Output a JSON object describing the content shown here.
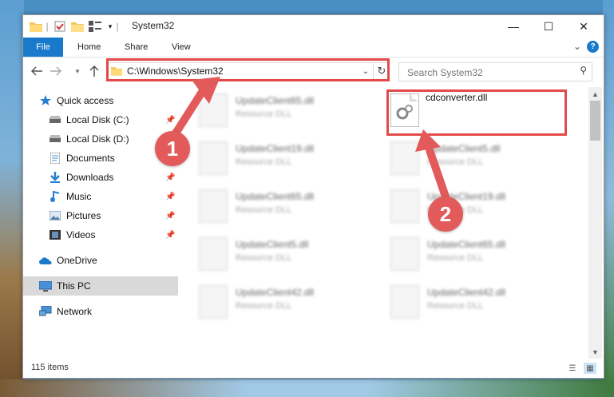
{
  "window": {
    "title": "System32",
    "controls": {
      "minimize": "—",
      "maximize": "☐",
      "close": "✕"
    }
  },
  "ribbon": {
    "tabs": [
      {
        "label": "File",
        "active": true
      },
      {
        "label": "Home"
      },
      {
        "label": "Share"
      },
      {
        "label": "View"
      }
    ],
    "help": "?"
  },
  "navbar": {
    "address": "C:\\Windows\\System32",
    "search_placeholder": "Search System32"
  },
  "sidebar": {
    "items": [
      {
        "label": "Quick access",
        "icon": "star-icon",
        "pinned": false
      },
      {
        "label": "Local Disk (C:)",
        "icon": "drive-icon",
        "pinned": true
      },
      {
        "label": "Local Disk (D:)",
        "icon": "drive-icon",
        "pinned": false
      },
      {
        "label": "Documents",
        "icon": "documents-icon",
        "pinned": true
      },
      {
        "label": "Downloads",
        "icon": "download-icon",
        "pinned": true
      },
      {
        "label": "Music",
        "icon": "music-icon",
        "pinned": true
      },
      {
        "label": "Pictures",
        "icon": "pictures-icon",
        "pinned": true
      },
      {
        "label": "Videos",
        "icon": "videos-icon",
        "pinned": true
      },
      {
        "label": "OneDrive",
        "icon": "cloud-icon",
        "pinned": false
      },
      {
        "label": "This PC",
        "icon": "pc-icon",
        "pinned": false,
        "selected": true
      },
      {
        "label": "Network",
        "icon": "network-icon",
        "pinned": false
      }
    ]
  },
  "files": [
    {
      "name": "UpdateClient65.dll",
      "type": "Resource DLL"
    },
    {
      "name": "cdconverter.dll",
      "type": ""
    },
    {
      "name": "UpdateClient19.dll",
      "type": "Resource DLL"
    },
    {
      "name": "UpdateClient5.dll",
      "type": "Resource DLL"
    },
    {
      "name": "UpdateClient65.dll",
      "type": "Resource DLL"
    },
    {
      "name": "UpdateClient19.dll",
      "type": "Resource DLL"
    },
    {
      "name": "UpdateClient5.dll",
      "type": "Resource DLL"
    },
    {
      "name": "UpdateClient65.dll",
      "type": "Resource DLL"
    },
    {
      "name": "UpdateClient42.dll",
      "type": "Resource DLL"
    },
    {
      "name": "UpdateClient42.dll",
      "type": "Resource DLL"
    }
  ],
  "status": {
    "items_count": "115 items"
  },
  "annotations": {
    "step1": "1",
    "step2": "2"
  },
  "colors": {
    "accent": "#1979ca",
    "highlight": "#e34a4a",
    "badge": "#e35a5a",
    "selected": "#d9d9d9"
  }
}
